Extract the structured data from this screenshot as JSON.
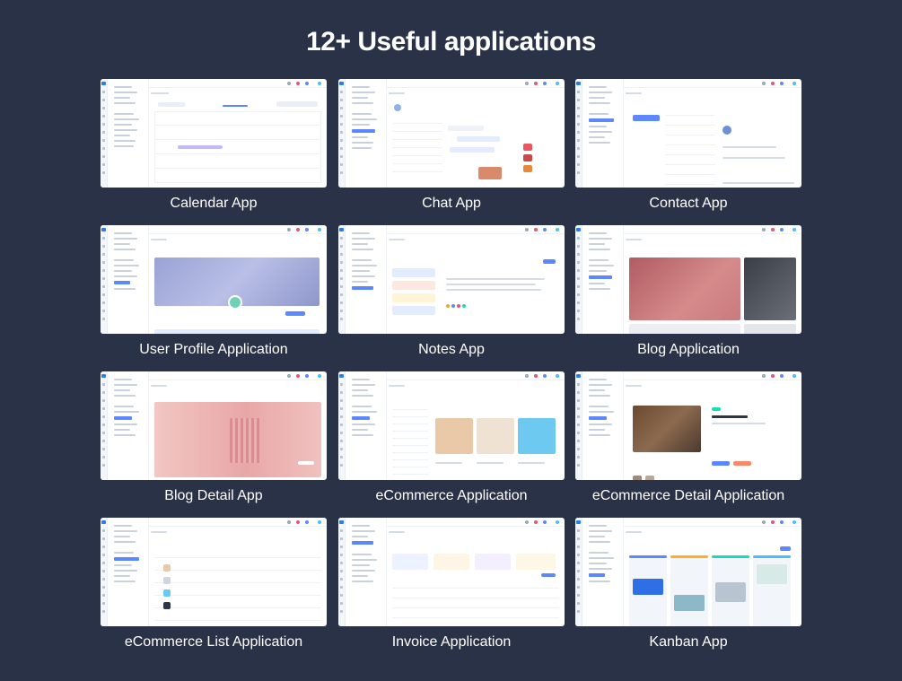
{
  "page": {
    "title": "12+ Useful applications"
  },
  "apps": [
    {
      "name": "Calendar App"
    },
    {
      "name": "Chat App"
    },
    {
      "name": "Contact App"
    },
    {
      "name": "User Profile Application"
    },
    {
      "name": "Notes App"
    },
    {
      "name": "Blog Application"
    },
    {
      "name": "Blog Detail App"
    },
    {
      "name": "eCommerce Application"
    },
    {
      "name": "eCommerce Detail Application"
    },
    {
      "name": "eCommerce List Application"
    },
    {
      "name": "Invoice Application"
    },
    {
      "name": "Kanban App"
    }
  ],
  "colors": {
    "background": "#2a3247",
    "accent": "#5d87ff",
    "card": "#ffffff",
    "caption": "#ffffff"
  }
}
